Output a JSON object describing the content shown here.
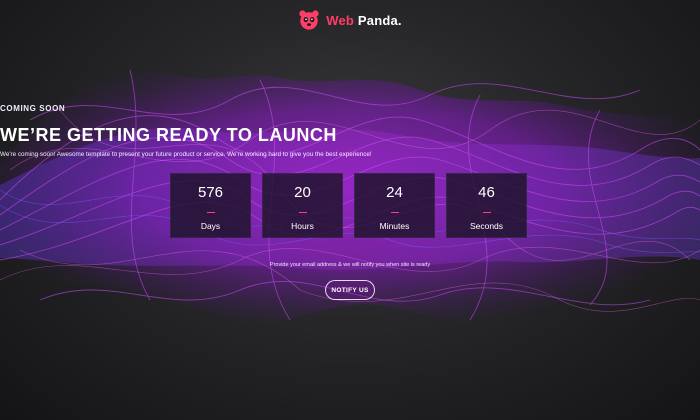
{
  "header": {
    "brand_part1": "Web",
    "brand_part2": " Panda.",
    "logo_icon": "panda-icon"
  },
  "hero": {
    "eyebrow": "COMING SOON",
    "headline": "WE’RE GETTING READY TO LAUNCH",
    "subtext": "We're coming soon! Awesome template to present your future product or service. We're working hard to give you the best experience!"
  },
  "countdown": [
    {
      "value": "576",
      "label": "Days"
    },
    {
      "value": "20",
      "label": "Hours"
    },
    {
      "value": "24",
      "label": "Minutes"
    },
    {
      "value": "46",
      "label": "Seconds"
    }
  ],
  "notify": {
    "text": "Provide your email address & we will notify you when site is ready",
    "button_label": "NOTIFY US"
  },
  "colors": {
    "accent": "#ff3d67",
    "wave_primary": "#b11ee8",
    "wave_secondary": "#6a3cf0",
    "background": "#1c1c1f"
  }
}
